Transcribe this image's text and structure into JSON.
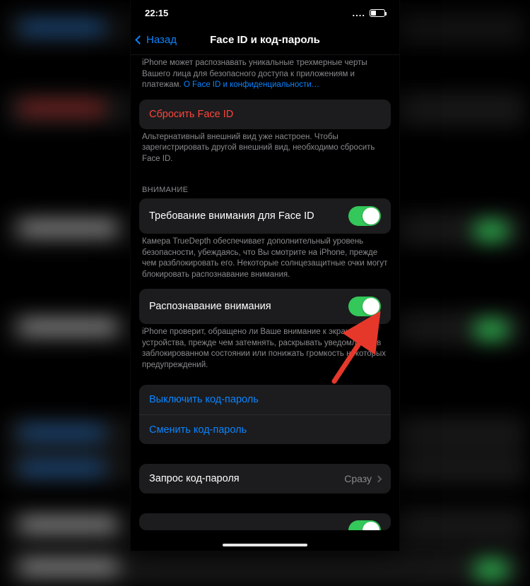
{
  "status": {
    "time": "22:15",
    "cellular": "...."
  },
  "nav": {
    "back": "Назад",
    "title": "Face ID и код-пароль"
  },
  "intro": {
    "text": "iPhone может распознавать уникальные трехмерные черты Вашего лица для безопасного доступа к приложениям и платежам.",
    "link": "О Face ID и конфиденциальности…"
  },
  "reset": {
    "label": "Сбросить Face ID",
    "desc": "Альтернативный внешний вид уже настроен. Чтобы зарегистрировать другой внешний вид, необходимо сбросить Face ID."
  },
  "attention": {
    "header": "ВНИМАНИЕ",
    "require": {
      "label": "Требование внимания для Face ID",
      "on": true
    },
    "require_desc": "Камера TrueDepth обеспечивает дополнительный уровень безопасности, убеждаясь, что Вы смотрите на iPhone, прежде чем разблокировать его. Некоторые солнцезащитные очки могут блокировать распознавание внимания.",
    "aware": {
      "label": "Распознавание внимания",
      "on": true
    },
    "aware_desc": "iPhone проверит, обращено ли Ваше внимание к экрану устройства, прежде чем затемнять, раскрывать уведомления в заблокированном состоянии или понижать громкость некоторых предупреждений."
  },
  "passcode": {
    "disable": "Выключить код-пароль",
    "change": "Сменить код-пароль",
    "require_label": "Запрос код-пароля",
    "require_value": "Сразу"
  },
  "colors": {
    "blue": "#0b84ff",
    "red": "#ff453a",
    "green": "#34c759",
    "cell_bg": "#1c1c1e",
    "muted": "#8a8a8e"
  }
}
